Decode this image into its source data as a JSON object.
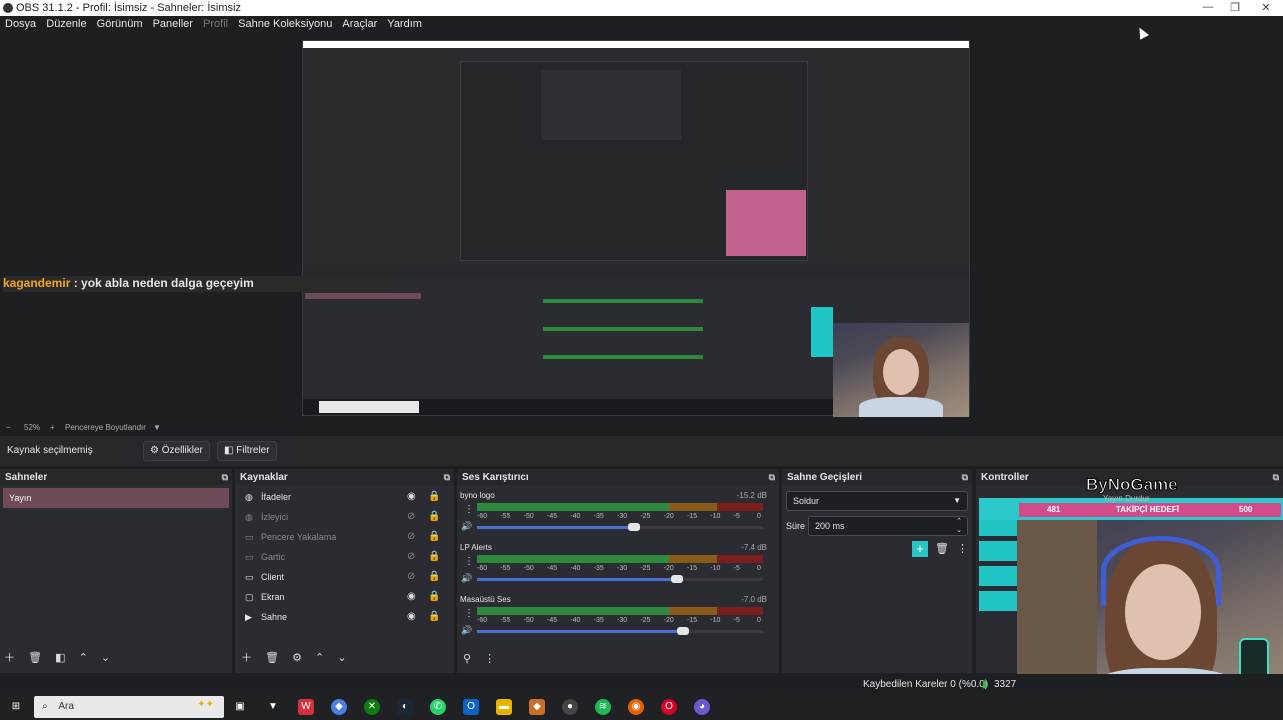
{
  "window": {
    "title": "OBS 31.1.2 - Profil: İsimsiz - Sahneler: İsimsiz",
    "controls": [
      "—",
      "❐",
      "✕"
    ]
  },
  "menu": [
    "Dosya",
    "Düzenle",
    "Görünüm",
    "Paneller",
    "Profil",
    "Sahne Koleksiyonu",
    "Araçlar",
    "Yardım"
  ],
  "preview": {
    "chat_user": "kagandemir",
    "chat_message": " : yok abla neden dalga geçeyim",
    "zoom": "52%",
    "resize_label": "Pencereye Boyutlandır"
  },
  "source_toolbar": {
    "status": "Kaynak seçilmemiş",
    "properties": "Özellikler",
    "filters": "Filtreler"
  },
  "scenes": {
    "title": "Sahneler",
    "items": [
      "Yayın"
    ]
  },
  "sources": {
    "title": "Kaynaklar",
    "items": [
      {
        "label": "İfadeler",
        "icon": "globe-icon",
        "visible": true,
        "dim": false
      },
      {
        "label": "İzleyici",
        "icon": "globe-icon",
        "visible": false,
        "dim": true
      },
      {
        "label": "Pencere Yakalama",
        "icon": "window-icon",
        "visible": false,
        "dim": true
      },
      {
        "label": "Gartic",
        "icon": "window-icon",
        "visible": false,
        "dim": true
      },
      {
        "label": "Client",
        "icon": "window-icon",
        "visible": false,
        "dim": false
      },
      {
        "label": "Ekran",
        "icon": "monitor-icon",
        "visible": true,
        "dim": false
      },
      {
        "label": "Sahne",
        "icon": "play-icon",
        "visible": true,
        "dim": false
      }
    ]
  },
  "mixer": {
    "title": "Ses Karıştırıcı",
    "ticks": [
      "-60",
      "-55",
      "-50",
      "-45",
      "-40",
      "-35",
      "-30",
      "-25",
      "-20",
      "-15",
      "-10",
      "-5",
      "0"
    ],
    "channels": [
      {
        "name": "byno logo",
        "db": "-15.2 dB",
        "volume": 0.55
      },
      {
        "name": "LP Alerts",
        "db": "-7.4 dB",
        "volume": 0.7
      },
      {
        "name": "Masaüstü Ses",
        "db": "-7.0 dB",
        "volume": 0.72
      }
    ]
  },
  "transitions": {
    "title": "Sahne Geçişleri",
    "selected": "Soldur",
    "duration_label": "Süre",
    "duration_value": "200 ms"
  },
  "controls": {
    "title": "Kontroller"
  },
  "overlay": {
    "brand": "ByNoGame",
    "goal_current": "481",
    "goal_label": "TAKİPÇİ HEDEFİ",
    "goal_target": "500",
    "subline": "Yayın Durdur"
  },
  "status": {
    "dropped": "Kaybedilen Kareler 0 (%0.0)",
    "bitrate": "3327"
  },
  "taskbar": {
    "search_placeholder": "Ara"
  },
  "colors": {
    "accent_teal": "#22c5c5",
    "scene_selected": "#6e4a58",
    "meter_green": "#2d8a3c"
  }
}
